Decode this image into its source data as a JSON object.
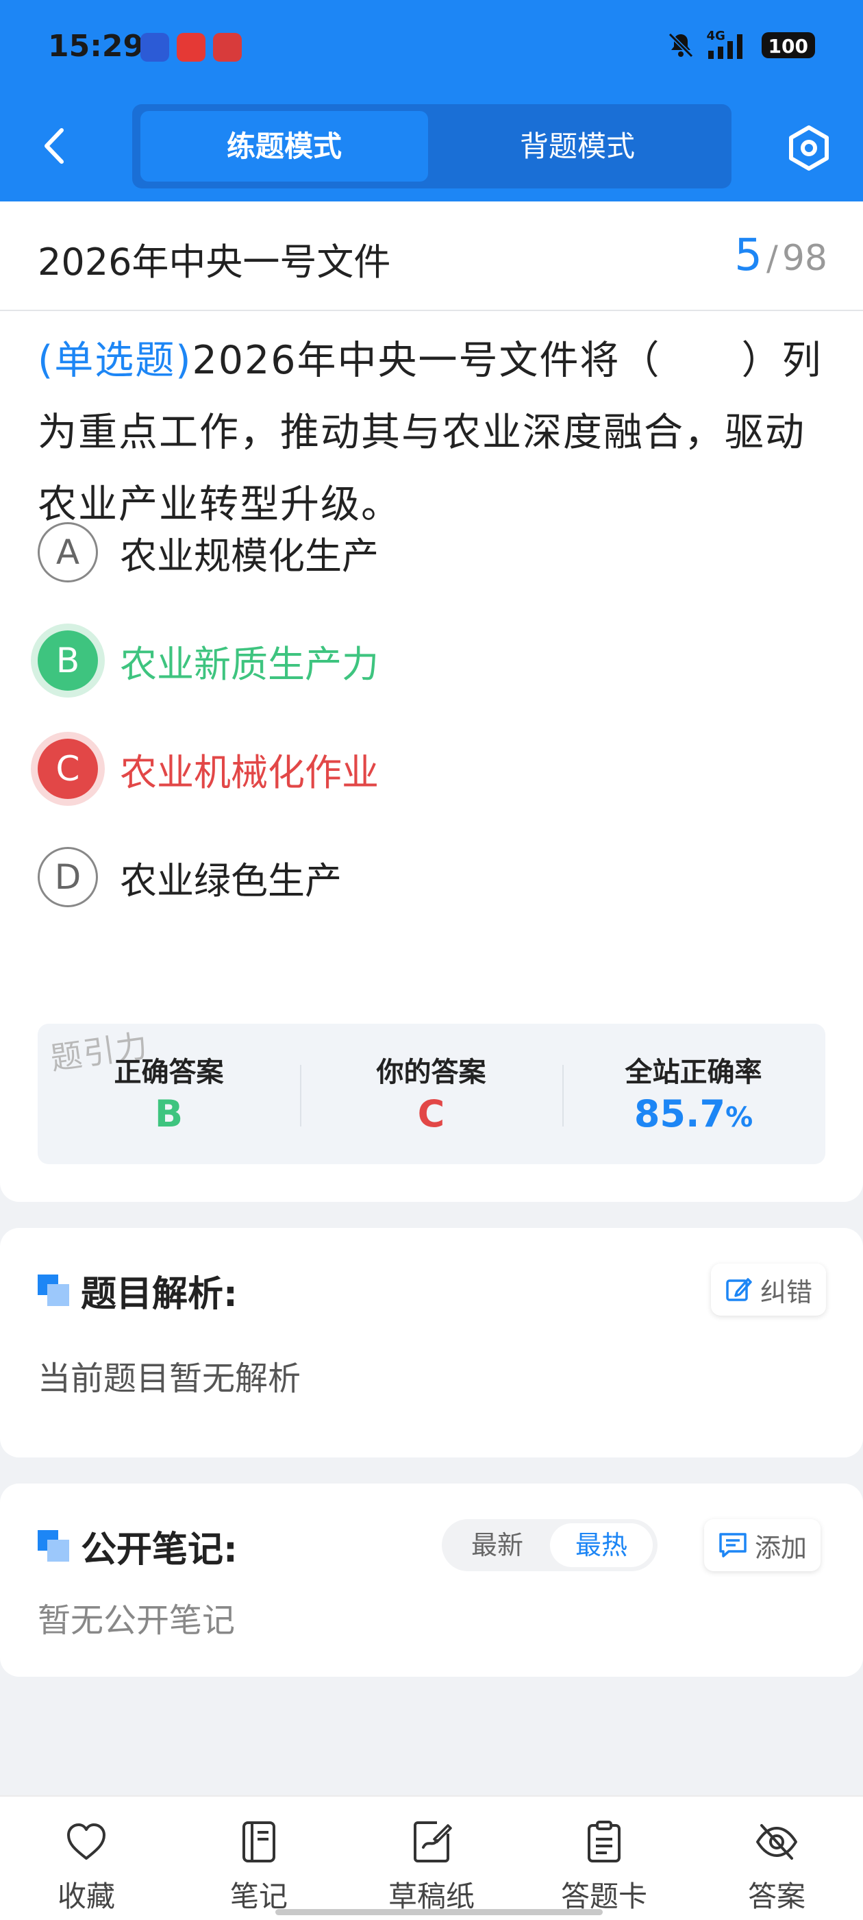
{
  "status_bar": {
    "time": "15:29",
    "network": "4G",
    "battery": "100"
  },
  "header": {
    "mode_practice": "练题模式",
    "mode_review": "背题模式"
  },
  "question_card": {
    "doc_title": "2026年中央一号文件",
    "current_index": "5",
    "separator": "/",
    "total": "98",
    "question_type": "(单选题)",
    "question_text": "2026年中央一号文件将（　　）列为重点工作，推动其与农业深度融合，驱动农业产业转型升级。",
    "options": [
      {
        "letter": "A",
        "text": "农业规模化生产",
        "state": "normal"
      },
      {
        "letter": "B",
        "text": "农业新质生产力",
        "state": "correct"
      },
      {
        "letter": "C",
        "text": "农业机械化作业",
        "state": "wrong"
      },
      {
        "letter": "D",
        "text": "农业绿色生产",
        "state": "normal"
      }
    ],
    "stats": {
      "correct_label": "正确答案",
      "correct_value": "B",
      "yours_label": "你的答案",
      "yours_value": "C",
      "rate_label": "全站正确率",
      "rate_value": "85.7",
      "rate_unit": "%"
    },
    "watermark": "题引力"
  },
  "analysis": {
    "title": "题目解析:",
    "report_label": "纠错",
    "body": "当前题目暂无解析"
  },
  "notes": {
    "title": "公开笔记:",
    "sort_newest": "最新",
    "sort_hottest": "最热",
    "add_label": "添加",
    "body": "暂无公开笔记"
  },
  "bottom_nav": {
    "favorite": "收藏",
    "notes": "笔记",
    "scratch": "草稿纸",
    "answer_card": "答题卡",
    "answer": "答案"
  },
  "colors": {
    "primary": "#1d86f5",
    "correct": "#3ec47f",
    "wrong": "#e24747"
  }
}
